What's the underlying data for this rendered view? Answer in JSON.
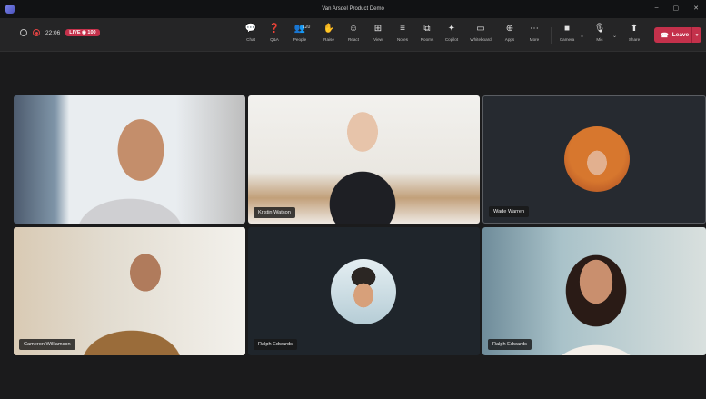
{
  "window": {
    "title": "Van Arsdel Product Demo"
  },
  "meeting": {
    "timer": "22:06",
    "live_label": "LIVE",
    "live_count": "100"
  },
  "toolbar": {
    "buttons": [
      {
        "label": "Chat",
        "icon": "chat-icon",
        "glyph": "💬"
      },
      {
        "label": "Q&A",
        "icon": "qna-icon",
        "glyph": "❓"
      },
      {
        "label": "People",
        "icon": "people-icon",
        "glyph": "👥",
        "count": "120"
      },
      {
        "label": "Raise",
        "icon": "raise-hand-icon",
        "glyph": "✋"
      },
      {
        "label": "React",
        "icon": "react-icon",
        "glyph": "☺"
      },
      {
        "label": "View",
        "icon": "view-icon",
        "glyph": "⊞"
      },
      {
        "label": "Notes",
        "icon": "notes-icon",
        "glyph": "≡"
      },
      {
        "label": "Rooms",
        "icon": "rooms-icon",
        "glyph": "⧉"
      },
      {
        "label": "Copilot",
        "icon": "copilot-icon",
        "glyph": "✦"
      },
      {
        "label": "Whiteboard",
        "icon": "whiteboard-icon",
        "glyph": "▭"
      },
      {
        "label": "Apps",
        "icon": "apps-icon",
        "glyph": "⊕"
      },
      {
        "label": "More",
        "icon": "more-icon",
        "glyph": "⋯"
      }
    ],
    "controls": [
      {
        "label": "Camera",
        "icon": "camera-icon",
        "glyph": "■"
      },
      {
        "label": "Mic",
        "icon": "mic-icon",
        "glyph": "🎙"
      },
      {
        "label": "Share",
        "icon": "share-icon",
        "glyph": "⬆"
      }
    ],
    "leave_label": "Leave"
  },
  "participants": [
    {
      "name": "",
      "tile": "video"
    },
    {
      "name": "Kristin Watson",
      "tile": "video"
    },
    {
      "name": "Wade Warren",
      "tile": "avatar"
    },
    {
      "name": "Cameron Williamson",
      "tile": "video"
    },
    {
      "name": "Ralph Edwards",
      "tile": "avatar"
    },
    {
      "name": "Ralph Edwards",
      "tile": "video"
    }
  ]
}
